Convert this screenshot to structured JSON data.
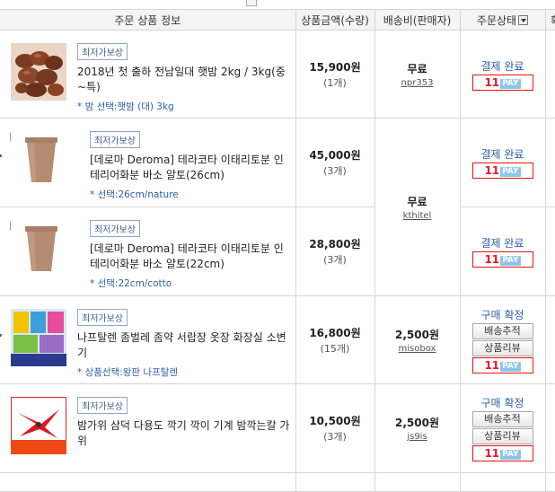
{
  "header": {
    "col_info": "주문 상품 정보",
    "col_price": "상품금액(수량)",
    "col_ship": "배송비(판매자)",
    "col_status": "주문상태",
    "col_extra": "확"
  },
  "pay_label": {
    "n": "11",
    "p": "PAY"
  },
  "orders": [
    {
      "badge": "최저가보상",
      "name": "2018년 첫 출하 전남일대 햇밤 2kg / 3kg(중~특)",
      "option": "* 밤 선택:햇밤 (대) 3kg",
      "price": "15,900원",
      "qty": "(1개)",
      "ship_fee": "무료",
      "seller": "npr353",
      "status": "결제 완료"
    },
    {
      "badge": "최저가보상",
      "name": "[데로마 Deroma] 테라코타 이태리토분 인테리어화분 바소 얄토(26cm)",
      "option": "* 선택:26cm/nature",
      "price": "45,000원",
      "qty": "(3개)",
      "status": "결제 완료"
    },
    {
      "badge": "최저가보상",
      "name": "[데로마 Deroma] 테라코타 이태리토분 인테리어화분 바소 얄토(22cm)",
      "option": "* 선택:22cm/cotto",
      "price": "28,800원",
      "qty": "(3개)",
      "status": "결제 완료"
    },
    {
      "badge": "최저가보상",
      "name": "나프탈렌 좀벌레 좀약 서랍장 옷장 화장실 소변기",
      "option": "* 상품선택:왕판 나프탈렌",
      "price": "16,800원",
      "qty": "(15개)",
      "ship_fee": "2,500원",
      "seller": "misobox",
      "status": "구매 확정",
      "btn_track": "배송추적",
      "btn_review": "상품리뷰",
      "thumb_label": "나프탈렌 최저가"
    },
    {
      "badge": "최저가보상",
      "name": "밤가위 삼덕 다용도 깍기 깍이 기계 밤깍는칼 가위",
      "option": "",
      "price": "10,500원",
      "qty": "(3개)",
      "ship_fee": "2,500원",
      "seller": "js9is",
      "status": "구매 확정",
      "btn_track": "배송추적",
      "btn_review": "상품리뷰",
      "thumb_label": "밤가위"
    }
  ],
  "shared_shipping": {
    "ship_fee": "무료",
    "seller": "kthitel"
  }
}
